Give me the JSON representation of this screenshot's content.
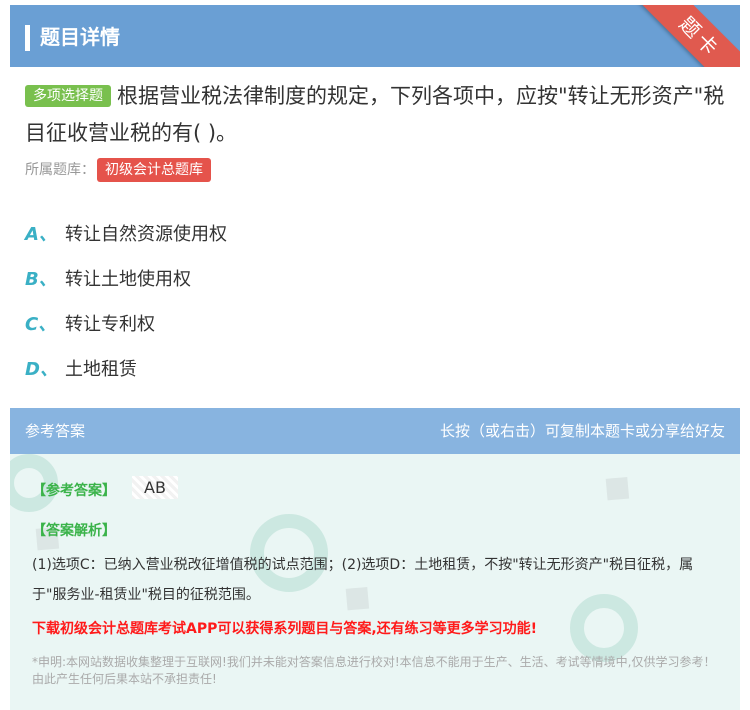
{
  "header": {
    "title": "题目详情",
    "ribbon_label": "题卡"
  },
  "question": {
    "type_badge": "多项选择题",
    "text": "根据营业税法律制度的规定，下列各项中，应按\"转让无形资产\"税目征收营业税的有( )。",
    "source_label": "所属题库：",
    "source_badge": "初级会计总题库"
  },
  "options": [
    {
      "letter": "A、",
      "text": "转让自然资源使用权"
    },
    {
      "letter": "B、",
      "text": "转让土地使用权"
    },
    {
      "letter": "C、",
      "text": "转让专利权"
    },
    {
      "letter": "D、",
      "text": "土地租赁"
    }
  ],
  "answer": {
    "header_left": "参考答案",
    "header_right": "长按（或右击）可复制本题卡或分享给好友",
    "answer_label": "【参考答案】",
    "answer_value": "AB",
    "analysis_label": "【答案解析】",
    "analysis_text": "(1)选项C：已纳入营业税改征增值税的试点范围；(2)选项D：土地租赁，不按\"转让无形资产\"税目征税，属于\"服务业-租赁业\"税目的征税范围。",
    "promo": "下载初级会计总题库考试APP可以获得系列题目与答案,还有练习等更多学习功能!",
    "disclaimer": "*申明:本网站数据收集整理于互联网!我们并未能对答案信息进行校对!本信息不能用于生产、生活、考试等情境中,仅供学习参考！由此产生任何后果本站不承担责任!"
  },
  "colors": {
    "header_bg": "#6a9fd4",
    "ribbon": "#e05a4f",
    "type_badge": "#79c04e",
    "source_badge": "#e5534b",
    "option_letter": "#3ab0c5",
    "answer_label": "#3bb34a",
    "promo": "#ff1a1a"
  },
  "icons": {
    "header_marker": "vertical-bar-icon"
  }
}
